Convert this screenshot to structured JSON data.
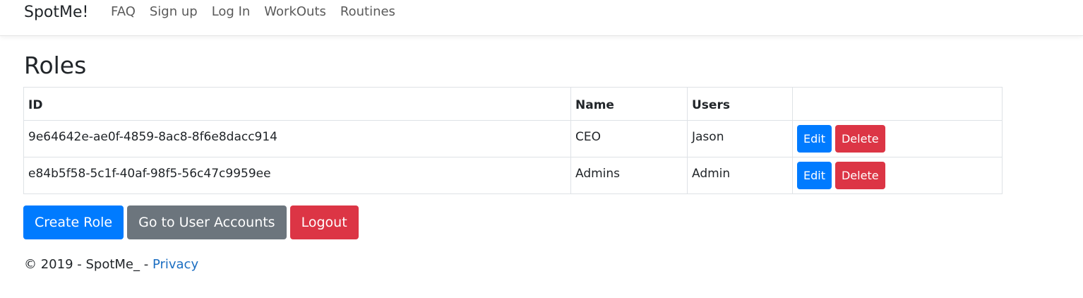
{
  "navbar": {
    "brand": "SpotMe!",
    "links": [
      "FAQ",
      "Sign up",
      "Log In",
      "WorkOuts",
      "Routines"
    ]
  },
  "page": {
    "title": "Roles"
  },
  "table": {
    "headers": [
      "ID",
      "Name",
      "Users",
      ""
    ],
    "rows": [
      {
        "id": "9e64642e-ae0f-4859-8ac8-8f6e8dacc914",
        "name": "CEO",
        "users": "Jason",
        "edit": "Edit",
        "delete": "Delete"
      },
      {
        "id": "e84b5f58-5c1f-40af-98f5-56c47c9959ee",
        "name": "Admins",
        "users": "Admin",
        "edit": "Edit",
        "delete": "Delete"
      }
    ]
  },
  "actions": {
    "create": "Create Role",
    "accounts": "Go to User Accounts",
    "logout": "Logout"
  },
  "footer": {
    "text": "© 2019 - SpotMe_ - ",
    "privacy": "Privacy"
  },
  "colors": {
    "primary": "#007bff",
    "danger": "#dc3545",
    "secondary": "#6c757d",
    "link": "#1b6ec2"
  }
}
